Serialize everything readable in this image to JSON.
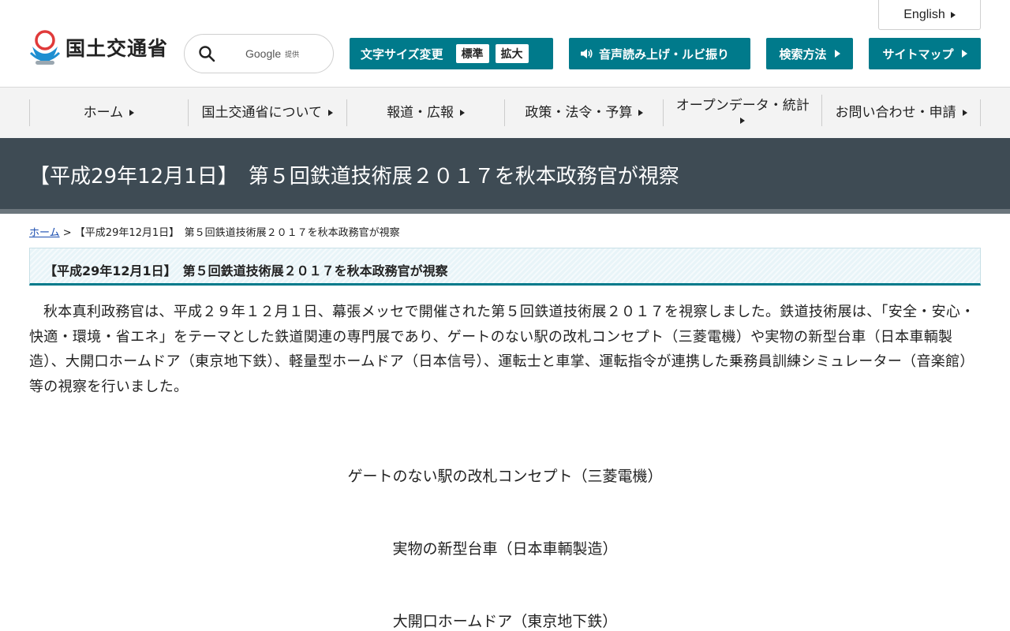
{
  "header": {
    "logo_text": "国土交通省",
    "english_label": "English",
    "search": {
      "brand": "Google",
      "brand_sub": "提供"
    },
    "font_size": {
      "label": "文字サイズ変更",
      "standard": "標準",
      "large": "拡大"
    },
    "voice_label": "音声読み上げ・ルビ振り",
    "search_method_label": "検索方法",
    "sitemap_label": "サイトマップ",
    "accent_color": "#007a8b"
  },
  "gnav": {
    "items": [
      {
        "label": "ホーム"
      },
      {
        "label": "国土交通省について"
      },
      {
        "label": "報道・広報"
      },
      {
        "label": "政策・法令・予算"
      },
      {
        "label": "オープンデータ・統計"
      },
      {
        "label": "お問い合わせ・申請"
      }
    ]
  },
  "band": {
    "title": "【平成29年12月1日】　第５回鉄道技術展２０１７を秋本政務官が視察",
    "color": "#3e4b54"
  },
  "breadcrumb": {
    "home": "ホーム",
    "separator": " > ",
    "current": "【平成29年12月1日】　第５回鉄道技術展２０１７を秋本政務官が視察"
  },
  "content": {
    "heading": "【平成29年12月1日】　第５回鉄道技術展２０１７を秋本政務官が視察",
    "paragraph": "秋本真利政務官は、平成２９年１２月１日、幕張メッセで開催された第５回鉄道技術展２０１７を視察しました。鉄道技術展は、「安全・安心・快適・環境・省エネ」をテーマとした鉄道関連の専門展であり、ゲートのない駅の改札コンセプト（三菱電機）や実物の新型台車（日本車輌製造）、大開口ホームドア（東京地下鉄）、軽量型ホームドア（日本信号）、運転士と車掌、運転指令が連携した乗務員訓練シミュレーター（音楽館）等の視察を行いました。",
    "captions": [
      "ゲートのない駅の改札コンセプト（三菱電機）",
      "実物の新型台車（日本車輌製造）",
      "大開口ホームドア（東京地下鉄）"
    ]
  }
}
